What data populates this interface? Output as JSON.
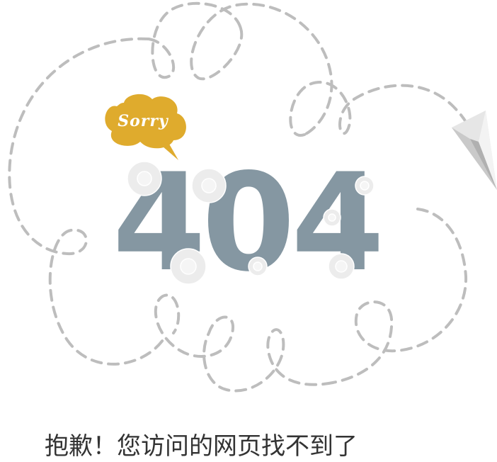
{
  "badge": {
    "label": "Sorry",
    "color": "#dfab2d"
  },
  "error": {
    "code": "404",
    "color": "#8597a2",
    "message": "抱歉！您访问的网页找不到了"
  },
  "decor": {
    "dash_color": "#bdbdbd",
    "flower_color": "#ececec",
    "plane_color": "#d9d9d9"
  }
}
